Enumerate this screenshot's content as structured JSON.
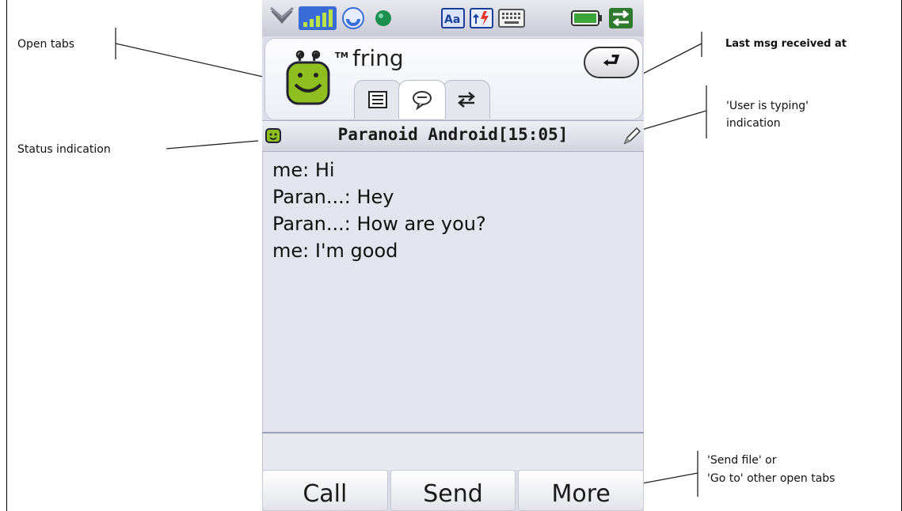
{
  "annotations": {
    "open_tabs": "Open tabs",
    "status_indication": "Status indication",
    "last_msg": "Last msg received at",
    "user_typing_line1": "'User is typing'",
    "user_typing_line2": "indication",
    "send_file_line1": "'Send file' or",
    "send_file_line2": "'Go to' other open tabs"
  },
  "status_bar": {
    "icons": [
      "dropdown-icon",
      "signal-strength-icon",
      "sync-icon",
      "globe-icon",
      "text-input-icon",
      "gprs-icon",
      "keyboard-icon",
      "battery-icon",
      "data-transfer-icon"
    ]
  },
  "header": {
    "app_name": "fring",
    "trademark": "TM",
    "back_icon": "back-arrow-icon"
  },
  "tabs": [
    {
      "icon": "contacts-list-icon",
      "active": false
    },
    {
      "icon": "chat-bubble-icon",
      "active": true
    },
    {
      "icon": "transfer-arrows-icon",
      "active": false
    }
  ],
  "conversation": {
    "title": "Paranoid Android[15:05]",
    "status_icon": "online-status-icon",
    "typing_icon": "pencil-icon"
  },
  "messages": [
    {
      "text": "me: Hi"
    },
    {
      "text": "Paran...: Hey"
    },
    {
      "text": "Paran...: How are you?"
    },
    {
      "text": "me: I'm good"
    }
  ],
  "input": {
    "value": ""
  },
  "softkeys": {
    "call": "Call",
    "send": "Send",
    "more": "More"
  },
  "colors": {
    "mascot": "#8fbf1e",
    "signal": "#3a6cd8",
    "battery": "#3aa63a"
  }
}
